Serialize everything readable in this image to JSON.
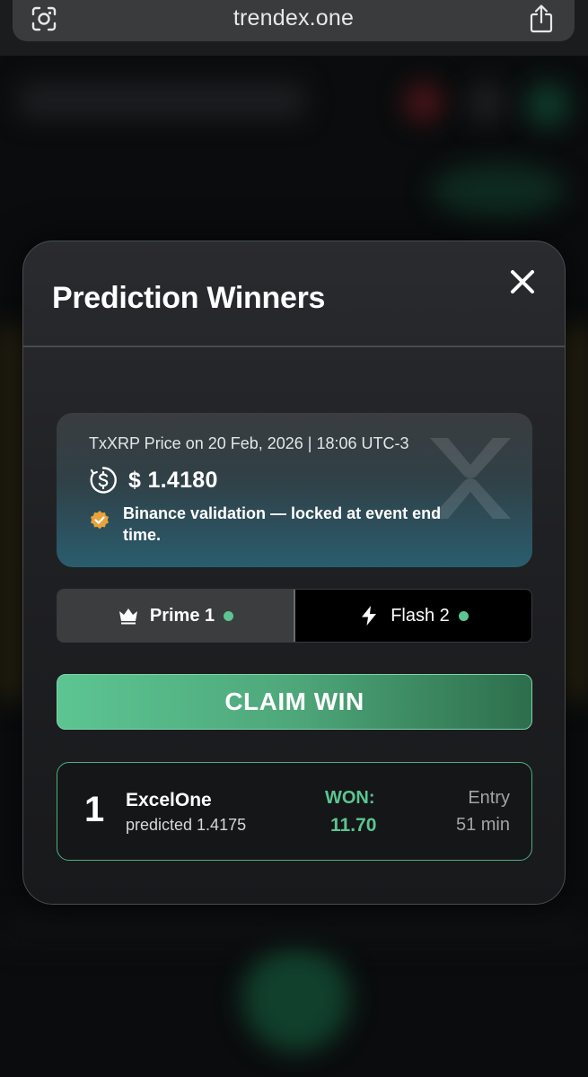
{
  "browser": {
    "url": "trendex.one"
  },
  "modal": {
    "title": "Prediction Winners",
    "price_card": {
      "caption": "TxXRP Price on 20 Feb, 2026 | 18:06 UTC-3",
      "price": "$ 1.4180",
      "validation_text": "Binance validation — locked at event end time."
    },
    "tabs": [
      {
        "label": "Prime 1",
        "icon": "crown-icon",
        "active": true
      },
      {
        "label": "Flash 2",
        "icon": "lightning-icon",
        "active": false
      }
    ],
    "claim_button": "CLAIM WIN",
    "winner": {
      "rank": "1",
      "name": "ExcelOne",
      "prediction": "predicted 1.4175",
      "won_label": "WON:",
      "won_value": "11.70",
      "entry_label": "Entry",
      "entry_value": "51 min"
    }
  },
  "colors": {
    "accent_green": "#5cc592",
    "modal_bg": "#1f2023"
  }
}
